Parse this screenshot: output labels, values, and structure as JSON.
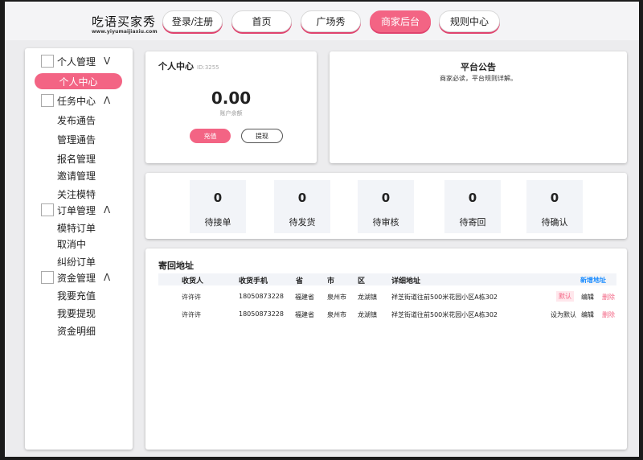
{
  "logo": {
    "name": "吃语买家秀",
    "url": "www.yiyumaijiaxiu.com"
  },
  "nav": [
    {
      "label": "登录/注册",
      "active": false
    },
    {
      "label": "首页",
      "active": false
    },
    {
      "label": "广场秀",
      "active": false
    },
    {
      "label": "商家后台",
      "active": true
    },
    {
      "label": "规则中心",
      "active": false
    }
  ],
  "sidebar": {
    "personal": {
      "label": "个人管理",
      "chevron": "V",
      "items": [
        "个人中心"
      ]
    },
    "task": {
      "label": "任务中心",
      "chevron": "Λ",
      "items": [
        "发布通告",
        "管理通告",
        "报名管理",
        "邀请管理",
        "关注模特"
      ]
    },
    "order": {
      "label": "订单管理",
      "chevron": "Λ",
      "items": [
        "模特订单",
        "取消中",
        "纠纷订单"
      ]
    },
    "funds": {
      "label": "资金管理",
      "chevron": "Λ",
      "items": [
        "我要充值",
        "我要提现",
        "资金明细"
      ]
    }
  },
  "personal_center": {
    "title": "个人中心",
    "id_text": "ID:3255",
    "balance": "0.00",
    "balance_label": "账户余额",
    "recharge_label": "充值",
    "withdraw_label": "提现"
  },
  "notice": {
    "title": "平台公告",
    "text": "商家必读，平台规则详解。"
  },
  "stats": [
    {
      "value": "0",
      "label": "待接单"
    },
    {
      "value": "0",
      "label": "待发货"
    },
    {
      "value": "0",
      "label": "待审核"
    },
    {
      "value": "0",
      "label": "待寄回"
    },
    {
      "value": "0",
      "label": "待确认"
    }
  ],
  "addresses": {
    "title": "寄回地址",
    "add_label": "新增地址",
    "headers": [
      "收货人",
      "收货手机",
      "省",
      "市",
      "区",
      "详细地址"
    ],
    "rows": [
      {
        "name": "许许许",
        "phone": "18050873228",
        "province": "福建省",
        "city": "泉州市",
        "district": "龙湖镇",
        "detail": "祥芝街道往前500米花园小区A栋302",
        "set_label": "默认",
        "edit_label": "编辑",
        "delete_label": "删除"
      },
      {
        "name": "许许许",
        "phone": "18050873228",
        "province": "福建省",
        "city": "泉州市",
        "district": "龙湖镇",
        "detail": "祥芝街道往前500米花园小区A栋302",
        "set_label": "设为默认",
        "edit_label": "编辑",
        "delete_label": "删除"
      }
    ]
  }
}
